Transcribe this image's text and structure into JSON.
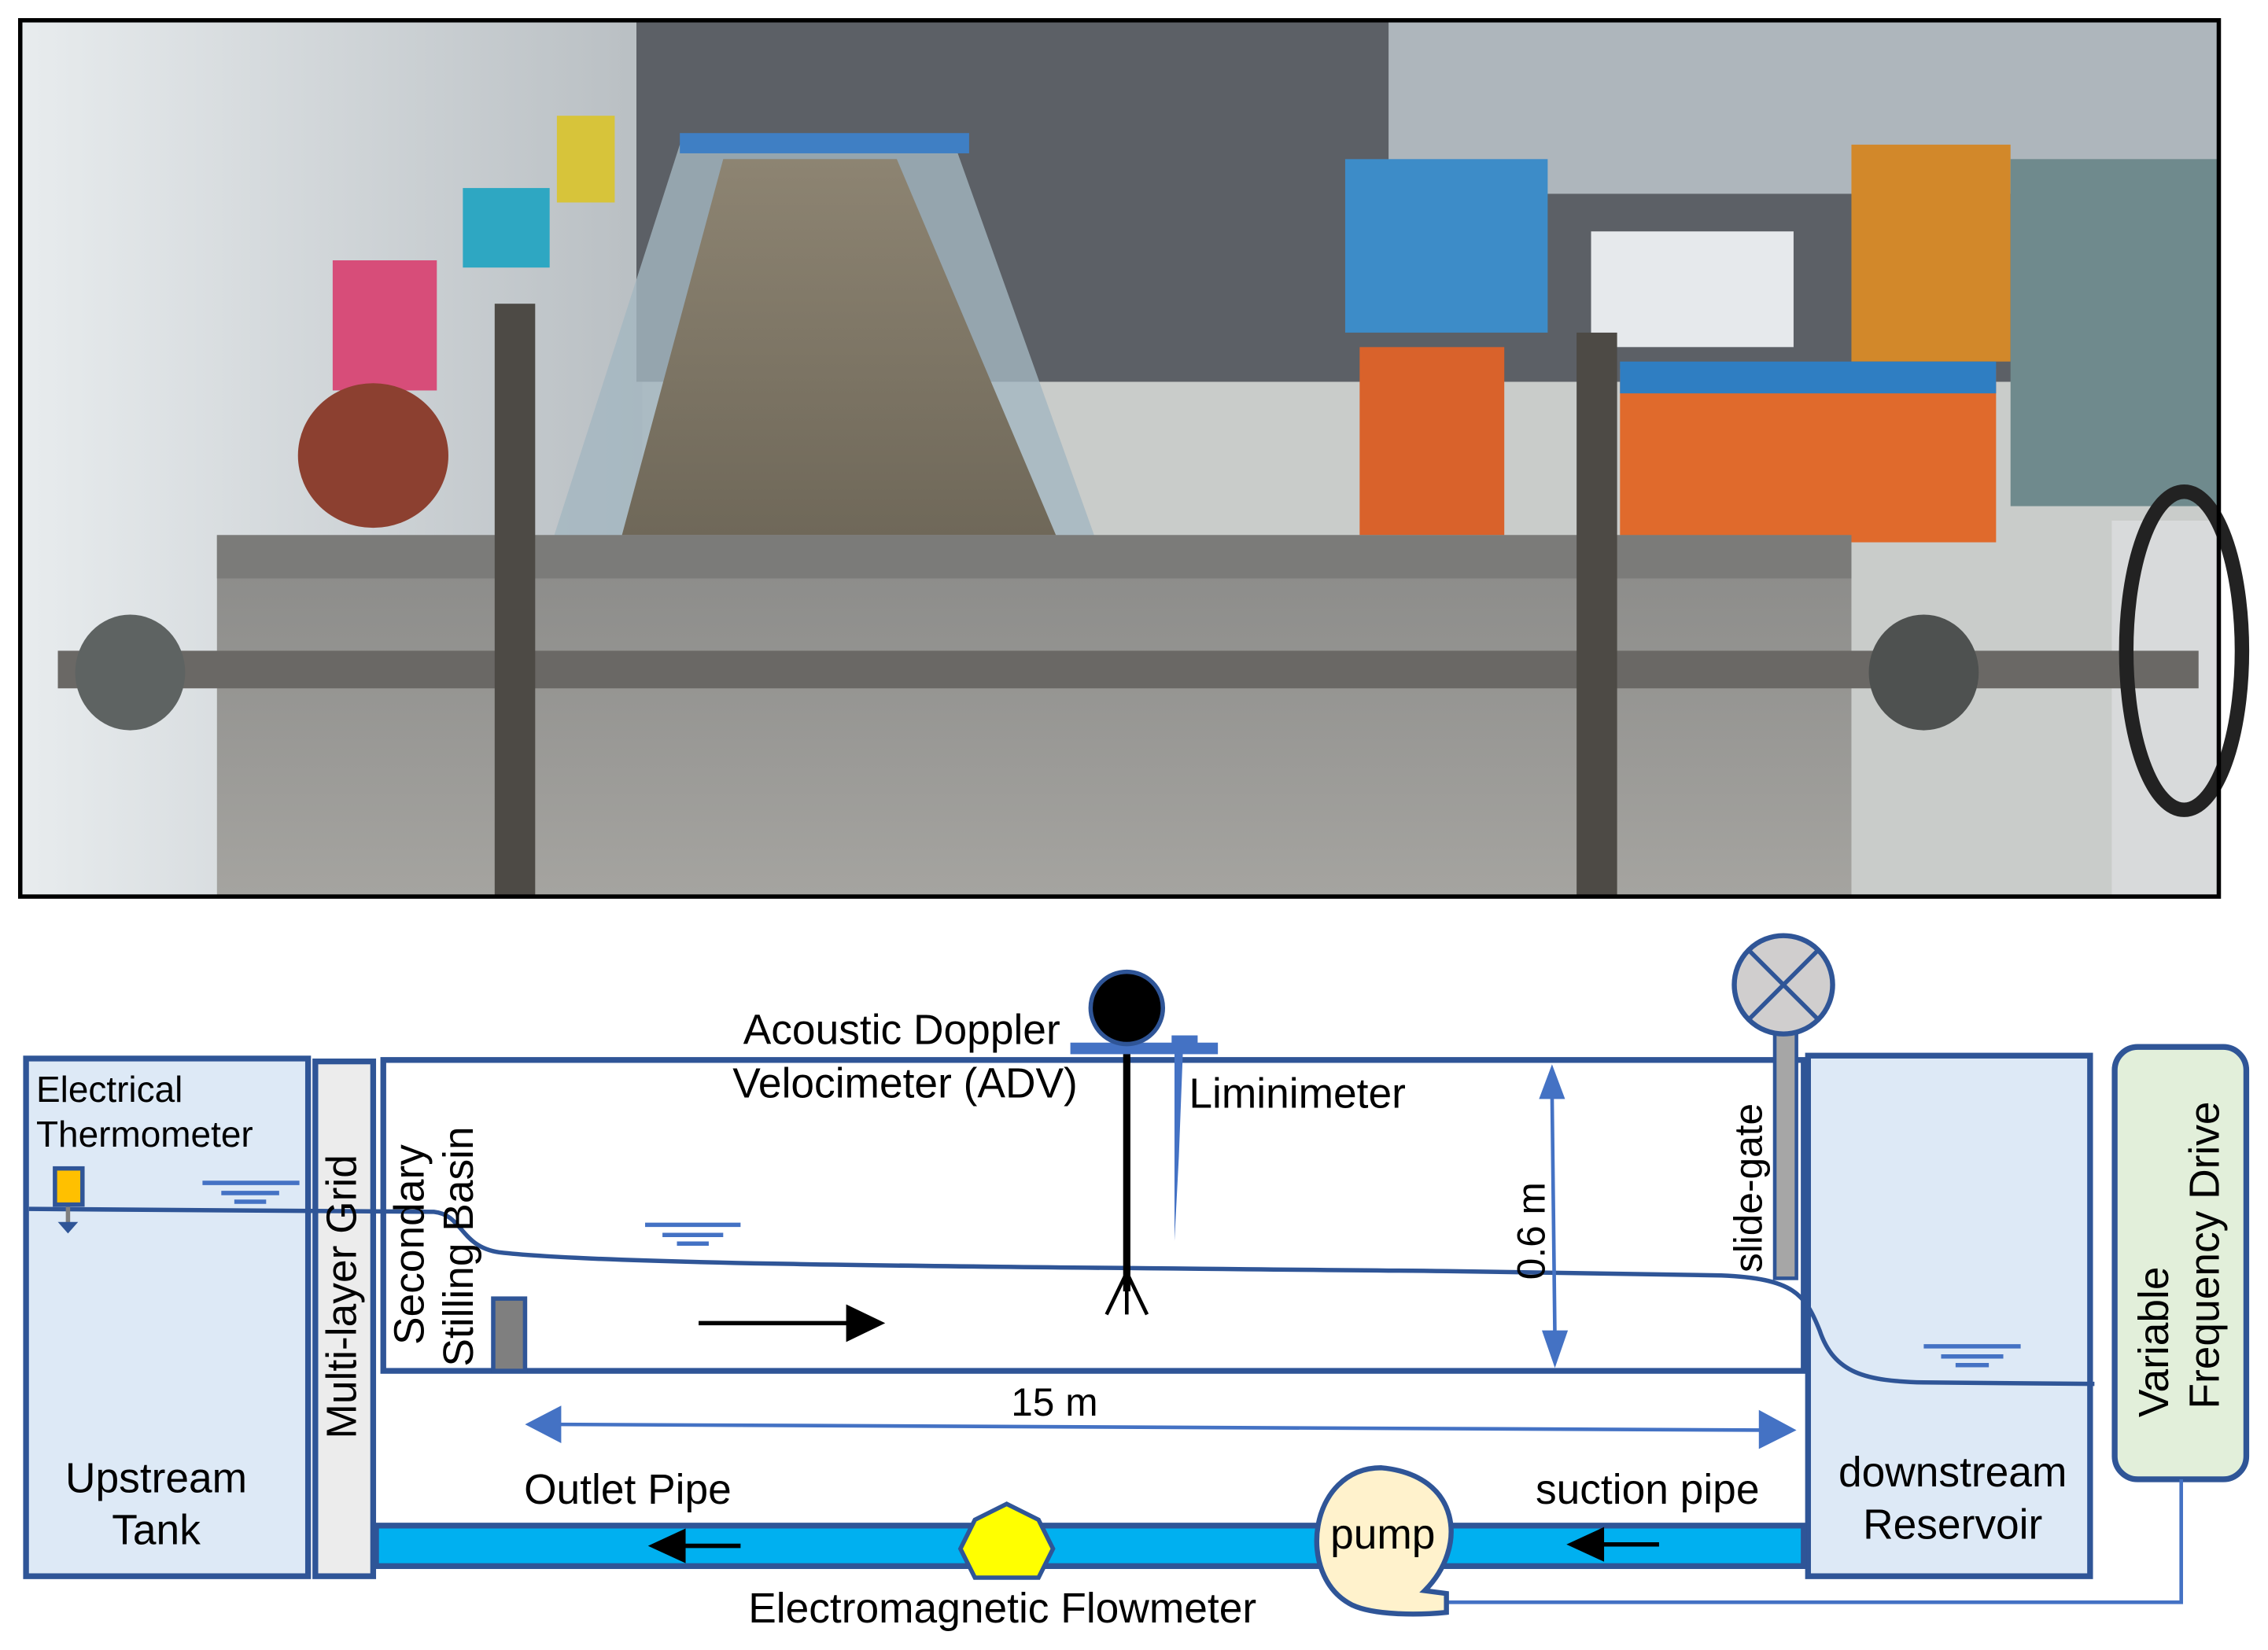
{
  "photo": {
    "description_icon": "flume-photo"
  },
  "labels": {
    "thermometer_1": "Electrical",
    "thermometer_2": "Thermometer",
    "upstream_1": "Upstream",
    "upstream_2": "Tank",
    "grid": "Multi-layer Grid",
    "stilling_1": "Secondary",
    "stilling_2": "Stilling Basin",
    "adv_1": "Acoustic Doppler",
    "adv_2": "Velocimeter (ADV)",
    "liminimeter": "Liminimeter",
    "height": "0.6 m",
    "slide_gate": "slide-gate",
    "length": "15 m",
    "outlet_pipe": "Outlet Pipe",
    "suction_pipe": "suction pipe",
    "pump": "pump",
    "flowmeter": "Electromagnetic Flowmeter",
    "downstream_1": "downstream",
    "downstream_2": "Reservoir",
    "vfd_1": "Variable",
    "vfd_2": "Frequency Drive"
  },
  "colors": {
    "outline": "#2f5597",
    "tank_fill": "#dde9f6",
    "pipe": "#00b0f0",
    "flowmeter": "#ffff00",
    "pump": "#fff2cc",
    "vfd": "#e2efda",
    "dimension": "#4472c4",
    "thermometer": "#ffc000"
  }
}
